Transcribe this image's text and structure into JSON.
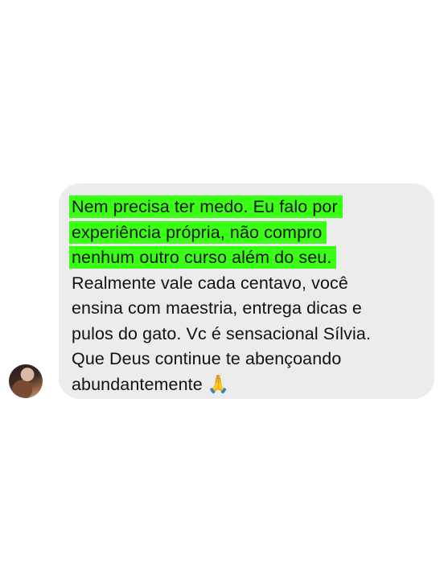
{
  "message": {
    "highlighted_lines": [
      "Nem precisa ter medo. Eu falo por",
      "experiência própria, não compro",
      "nenhum outro curso além do seu."
    ],
    "lines": [
      "Realmente vale cada centavo, você",
      "ensina com maestria, entrega dicas e",
      "pulos do gato. Vc é sensacional Sílvia.",
      "Que Deus continue te abençoando",
      "abundantemente"
    ],
    "emoji": "🙏",
    "highlight_color": "#39ff14",
    "bubble_color": "#ececec"
  },
  "sender": {
    "avatar_icon": "profile-photo"
  }
}
